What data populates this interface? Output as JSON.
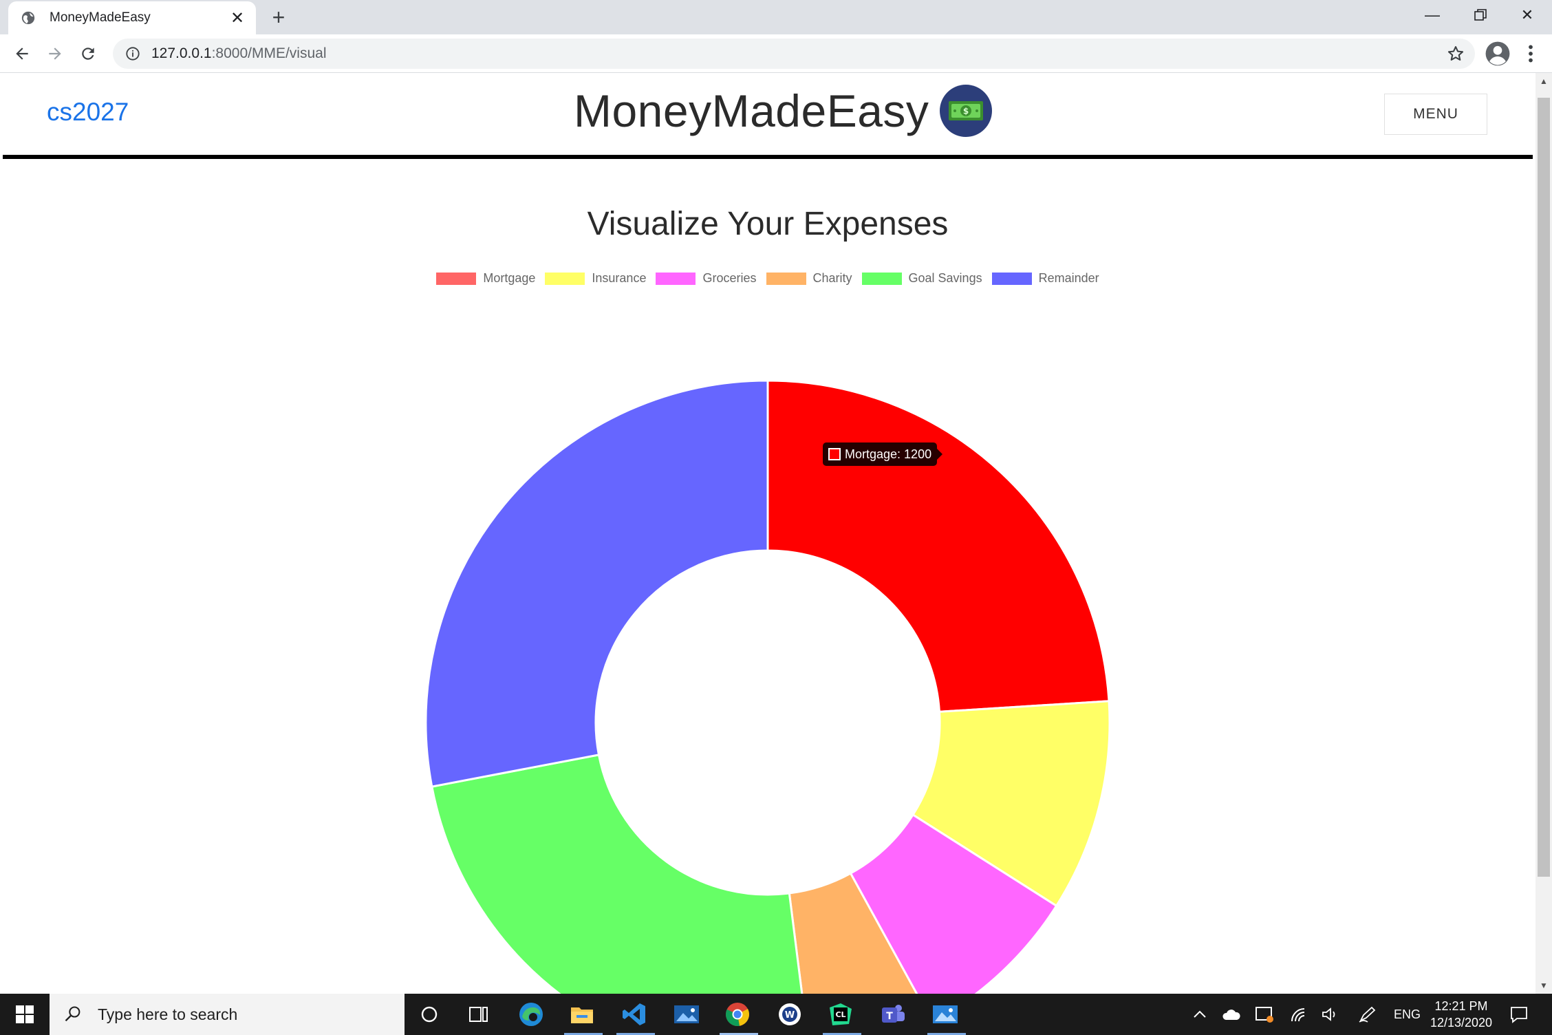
{
  "browser": {
    "tab_title": "MoneyMadeEasy",
    "url_host": "127.0.0.1",
    "url_path": ":8000/MME/visual"
  },
  "header": {
    "username": "cs2027",
    "brand_title": "MoneyMadeEasy",
    "menu_label": "MENU"
  },
  "chart_title": "Visualize Your Expenses",
  "chart_data": {
    "type": "pie",
    "variant": "doughnut",
    "title": "Visualize Your Expenses",
    "categories": [
      "Mortgage",
      "Insurance",
      "Groceries",
      "Charity",
      "Goal Savings",
      "Remainder"
    ],
    "values": [
      1200,
      500,
      400,
      300,
      1200,
      1400
    ],
    "colors": [
      "#ff0000",
      "#ffff66",
      "#ff66ff",
      "#ffb366",
      "#66ff66",
      "#6666ff"
    ],
    "legend_colors": [
      "#ff6666",
      "#ffff66",
      "#ff66ff",
      "#ffb366",
      "#66ff66",
      "#6666ff"
    ],
    "legend_position": "top",
    "tooltip": {
      "label": "Mortgage: 1200",
      "color": "#ff0000"
    }
  },
  "taskbar": {
    "search_placeholder": "Type here to search",
    "language": "ENG",
    "time": "12:21 PM",
    "date": "12/13/2020"
  }
}
